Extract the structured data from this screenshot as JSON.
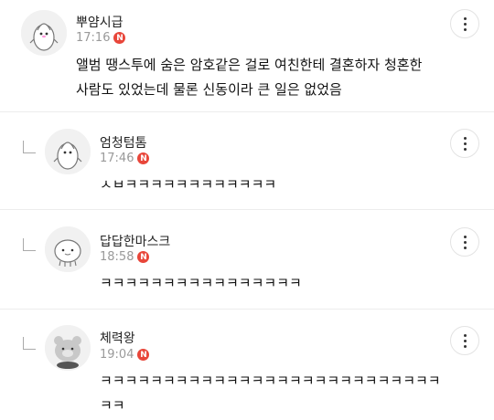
{
  "comments": [
    {
      "username": "뿌얌시급",
      "time": "17:16",
      "badge": "N",
      "text_lines": [
        "앨범 땡스투에 숨은 암호같은 걸로 여친한테 결혼하자 청혼한",
        "사람도 있었는데 물론 신동이라 큰 일은 없었음"
      ],
      "avatar_icon": "penguin-avatar-icon",
      "is_reply": false
    },
    {
      "username": "엄청텀톰",
      "time": "17:46",
      "badge": "N",
      "text_lines": [
        "ㅅㅂㅋㅋㅋㅋㅋㅋㅋㅋㅋㅋㅋㅋ"
      ],
      "avatar_icon": "penguin-avatar-icon",
      "is_reply": true
    },
    {
      "username": "답답한마스크",
      "time": "18:58",
      "badge": "N",
      "text_lines": [
        "ㅋㅋㅋㅋㅋㅋㅋㅋㅋㅋㅋㅋㅋㅋㅋㅋ"
      ],
      "avatar_icon": "blob-avatar-icon",
      "is_reply": true
    },
    {
      "username": "체력왕",
      "time": "19:04",
      "badge": "N",
      "text_lines": [
        "ㅋㅋㅋㅋㅋㅋㅋㅋㅋㅋㅋㅋㅋㅋㅋㅋㅋㅋㅋㅋㅋㅋㅋㅋㅋㅋㅋ",
        "ㅋㅋ"
      ],
      "avatar_icon": "bear-avatar-icon",
      "is_reply": true
    }
  ],
  "icons": {
    "more": "more-vertical-icon",
    "reply": "reply-arrow-icon"
  },
  "colors": {
    "badge": "#e8463a",
    "meta_text": "#9a9a9a",
    "divider": "#ececec"
  }
}
